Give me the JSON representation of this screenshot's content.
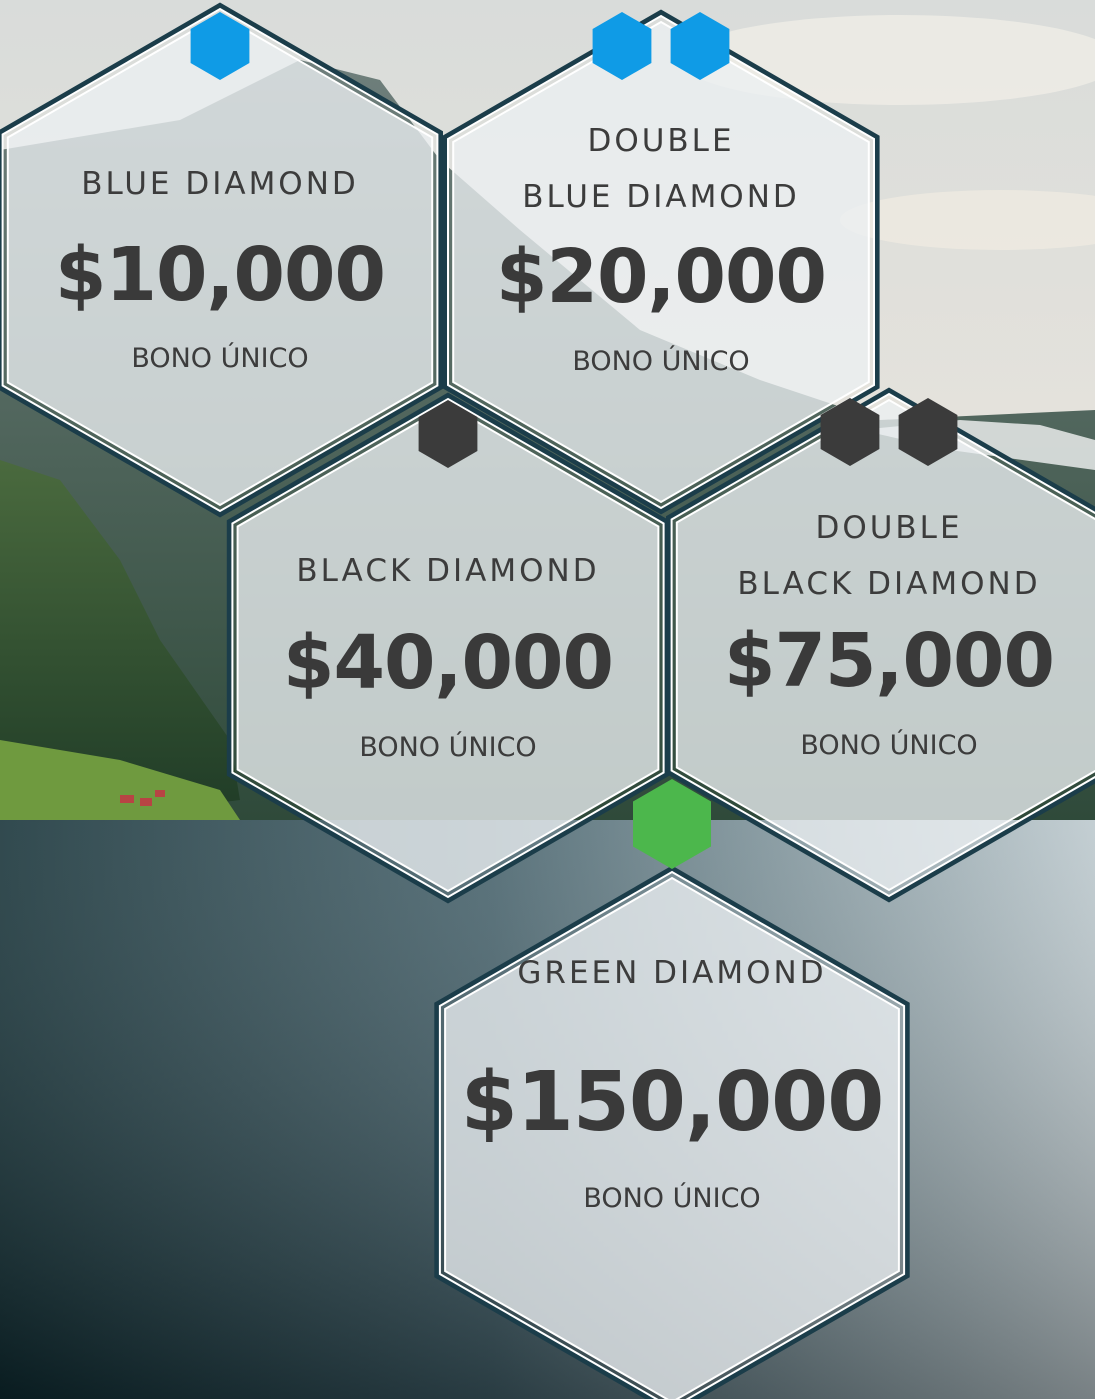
{
  "colors": {
    "blue": "#0f9be6",
    "black": "#3b3b3b",
    "green": "#4cb74c"
  },
  "tiers": [
    {
      "name_lines": [
        "BLUE DIAMOND"
      ],
      "amount": "$10,000",
      "bonus_label": "BONO ÚNICO",
      "badge_color": "blue",
      "badge_count": 1
    },
    {
      "name_lines": [
        "DOUBLE",
        "BLUE DIAMOND"
      ],
      "amount": "$20,000",
      "bonus_label": "BONO ÚNICO",
      "badge_color": "blue",
      "badge_count": 2
    },
    {
      "name_lines": [
        "BLACK DIAMOND"
      ],
      "amount": "$40,000",
      "bonus_label": "BONO ÚNICO",
      "badge_color": "black",
      "badge_count": 1
    },
    {
      "name_lines": [
        "DOUBLE",
        "BLACK DIAMOND"
      ],
      "amount": "$75,000",
      "bonus_label": "BONO ÚNICO",
      "badge_color": "black",
      "badge_count": 2
    },
    {
      "name_lines": [
        "GREEN DIAMOND"
      ],
      "amount": "$150,000",
      "bonus_label": "BONO ÚNICO",
      "badge_color": "green",
      "badge_count": 1
    }
  ]
}
